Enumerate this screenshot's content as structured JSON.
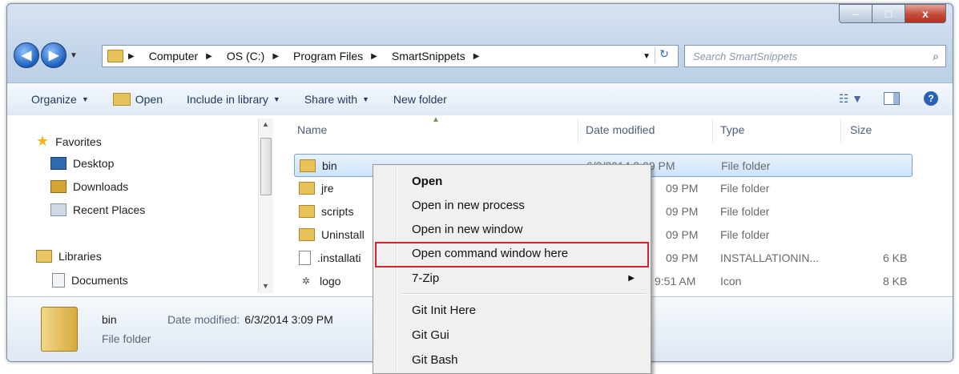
{
  "window": {
    "caption": {
      "minimize": "–",
      "maximize": "□",
      "close": "x"
    }
  },
  "address": {
    "crumbs": [
      "Computer",
      "OS (C:)",
      "Program Files",
      "SmartSnippets"
    ]
  },
  "search": {
    "placeholder": "Search SmartSnippets"
  },
  "toolbar": {
    "organize": "Organize",
    "open": "Open",
    "include": "Include in library",
    "share": "Share with",
    "new_folder": "New folder"
  },
  "navpane": {
    "favorites": "Favorites",
    "desktop": "Desktop",
    "downloads": "Downloads",
    "recent": "Recent Places",
    "libraries": "Libraries",
    "documents": "Documents"
  },
  "columns": {
    "name": "Name",
    "date": "Date modified",
    "type": "Type",
    "size": "Size"
  },
  "files": [
    {
      "name": "bin",
      "date": "6/3/2014 3:09 PM",
      "type": "File folder",
      "size": ""
    },
    {
      "name": "jre",
      "date": "09 PM",
      "type": "File folder",
      "size": ""
    },
    {
      "name": "scripts",
      "date": "09 PM",
      "type": "File folder",
      "size": ""
    },
    {
      "name": "Uninstall",
      "date": "09 PM",
      "type": "File folder",
      "size": ""
    },
    {
      "name": ".installati",
      "date": "09 PM",
      "type": "INSTALLATIONIN...",
      "size": "6 KB"
    },
    {
      "name": "logo",
      "date": "9:51 AM",
      "type": "Icon",
      "size": "8 KB"
    }
  ],
  "details": {
    "name": "bin",
    "type": "File folder",
    "modified_label": "Date modified:",
    "modified_value": "6/3/2014 3:09 PM"
  },
  "context_menu": {
    "items": [
      "Open",
      "Open in new process",
      "Open in new window",
      "Open command window here",
      "7-Zip",
      "Git Init Here",
      "Git Gui",
      "Git Bash"
    ]
  },
  "colors": {
    "highlight_border": "#d3232f",
    "selection": "#cde4fb"
  }
}
